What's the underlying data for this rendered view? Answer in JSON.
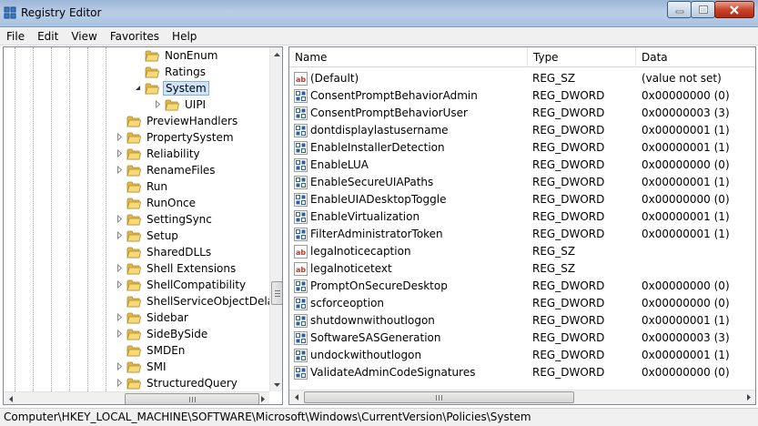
{
  "window": {
    "title": "Registry Editor",
    "minimize_icon": "minimize-icon",
    "maximize_icon": "maximize-icon",
    "close_icon": "close-icon"
  },
  "menu": {
    "items": [
      "File",
      "Edit",
      "View",
      "Favorites",
      "Help"
    ]
  },
  "tree": {
    "rows": [
      {
        "label": "NonEnum",
        "level": 2,
        "expander": "none",
        "selected": false
      },
      {
        "label": "Ratings",
        "level": 2,
        "expander": "none",
        "selected": false
      },
      {
        "label": "System",
        "level": 2,
        "expander": "expanded",
        "selected": true
      },
      {
        "label": "UIPI",
        "level": 3,
        "expander": "collapsed",
        "selected": false
      },
      {
        "label": "PreviewHandlers",
        "level": 1,
        "expander": "none",
        "selected": false
      },
      {
        "label": "PropertySystem",
        "level": 1,
        "expander": "collapsed",
        "selected": false
      },
      {
        "label": "Reliability",
        "level": 1,
        "expander": "collapsed",
        "selected": false
      },
      {
        "label": "RenameFiles",
        "level": 1,
        "expander": "collapsed",
        "selected": false
      },
      {
        "label": "Run",
        "level": 1,
        "expander": "none",
        "selected": false
      },
      {
        "label": "RunOnce",
        "level": 1,
        "expander": "none",
        "selected": false
      },
      {
        "label": "SettingSync",
        "level": 1,
        "expander": "collapsed",
        "selected": false
      },
      {
        "label": "Setup",
        "level": 1,
        "expander": "collapsed",
        "selected": false
      },
      {
        "label": "SharedDLLs",
        "level": 1,
        "expander": "none",
        "selected": false
      },
      {
        "label": "Shell Extensions",
        "level": 1,
        "expander": "collapsed",
        "selected": false
      },
      {
        "label": "ShellCompatibility",
        "level": 1,
        "expander": "collapsed",
        "selected": false
      },
      {
        "label": "ShellServiceObjectDelayL",
        "level": 1,
        "expander": "none",
        "selected": false
      },
      {
        "label": "Sidebar",
        "level": 1,
        "expander": "collapsed",
        "selected": false
      },
      {
        "label": "SideBySide",
        "level": 1,
        "expander": "collapsed",
        "selected": false
      },
      {
        "label": "SMDEn",
        "level": 1,
        "expander": "none",
        "selected": false
      },
      {
        "label": "SMI",
        "level": 1,
        "expander": "collapsed",
        "selected": false
      },
      {
        "label": "StructuredQuery",
        "level": 1,
        "expander": "collapsed",
        "selected": false
      }
    ]
  },
  "list": {
    "columns": [
      "Name",
      "Type",
      "Data"
    ],
    "rows": [
      {
        "icon": "string-value-icon",
        "name": "(Default)",
        "type": "REG_SZ",
        "data": "(value not set)"
      },
      {
        "icon": "binary-value-icon",
        "name": "ConsentPromptBehaviorAdmin",
        "type": "REG_DWORD",
        "data": "0x00000000 (0)"
      },
      {
        "icon": "binary-value-icon",
        "name": "ConsentPromptBehaviorUser",
        "type": "REG_DWORD",
        "data": "0x00000003 (3)"
      },
      {
        "icon": "binary-value-icon",
        "name": "dontdisplaylastusername",
        "type": "REG_DWORD",
        "data": "0x00000001 (1)"
      },
      {
        "icon": "binary-value-icon",
        "name": "EnableInstallerDetection",
        "type": "REG_DWORD",
        "data": "0x00000001 (1)"
      },
      {
        "icon": "binary-value-icon",
        "name": "EnableLUA",
        "type": "REG_DWORD",
        "data": "0x00000000 (0)"
      },
      {
        "icon": "binary-value-icon",
        "name": "EnableSecureUIAPaths",
        "type": "REG_DWORD",
        "data": "0x00000001 (1)"
      },
      {
        "icon": "binary-value-icon",
        "name": "EnableUIADesktopToggle",
        "type": "REG_DWORD",
        "data": "0x00000000 (0)"
      },
      {
        "icon": "binary-value-icon",
        "name": "EnableVirtualization",
        "type": "REG_DWORD",
        "data": "0x00000001 (1)"
      },
      {
        "icon": "binary-value-icon",
        "name": "FilterAdministratorToken",
        "type": "REG_DWORD",
        "data": "0x00000001 (1)"
      },
      {
        "icon": "string-value-icon",
        "name": "legalnoticecaption",
        "type": "REG_SZ",
        "data": ""
      },
      {
        "icon": "string-value-icon",
        "name": "legalnoticetext",
        "type": "REG_SZ",
        "data": ""
      },
      {
        "icon": "binary-value-icon",
        "name": "PromptOnSecureDesktop",
        "type": "REG_DWORD",
        "data": "0x00000000 (0)"
      },
      {
        "icon": "binary-value-icon",
        "name": "scforceoption",
        "type": "REG_DWORD",
        "data": "0x00000000 (0)"
      },
      {
        "icon": "binary-value-icon",
        "name": "shutdownwithoutlogon",
        "type": "REG_DWORD",
        "data": "0x00000001 (1)"
      },
      {
        "icon": "binary-value-icon",
        "name": "SoftwareSASGeneration",
        "type": "REG_DWORD",
        "data": "0x00000003 (3)"
      },
      {
        "icon": "binary-value-icon",
        "name": "undockwithoutlogon",
        "type": "REG_DWORD",
        "data": "0x00000001 (1)"
      },
      {
        "icon": "binary-value-icon",
        "name": "ValidateAdminCodeSignatures",
        "type": "REG_DWORD",
        "data": "0x00000000 (0)"
      }
    ]
  },
  "statusbar": {
    "path": "Computer\\HKEY_LOCAL_MACHINE\\SOFTWARE\\Microsoft\\Windows\\CurrentVersion\\Policies\\System"
  },
  "colors": {
    "selection": "#cfe4f8",
    "selection_border": "#84acdd",
    "folder": "#e8c35a"
  }
}
